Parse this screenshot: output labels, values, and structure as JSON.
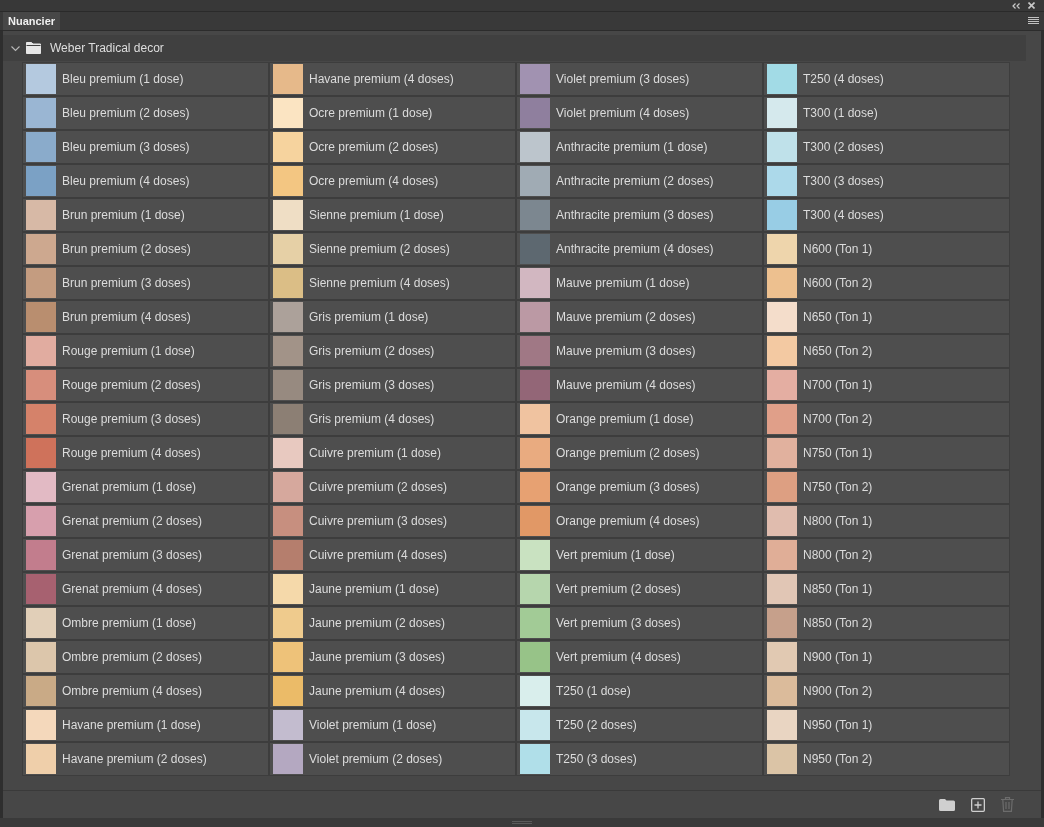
{
  "panel": {
    "tab": {
      "label": "Nuancier",
      "selected": true
    },
    "group": {
      "name": "Weber Tradical decor",
      "expanded": true
    },
    "swatches": [
      {
        "name": "Bleu premium (1 dose)",
        "color": "#b4c9df"
      },
      {
        "name": "Bleu premium (2 doses)",
        "color": "#9ab6d3"
      },
      {
        "name": "Bleu premium (3 doses)",
        "color": "#8aabcb"
      },
      {
        "name": "Bleu premium (4 doses)",
        "color": "#7ba1c5"
      },
      {
        "name": "Brun premium (1 dose)",
        "color": "#d7b9a6"
      },
      {
        "name": "Brun premium (2 doses)",
        "color": "#cda88f"
      },
      {
        "name": "Brun premium (3 doses)",
        "color": "#c49c80"
      },
      {
        "name": "Brun premium (4 doses)",
        "color": "#b98e6f"
      },
      {
        "name": "Rouge premium (1 dose)",
        "color": "#e1aca0"
      },
      {
        "name": "Rouge premium (2 doses)",
        "color": "#d78e7c"
      },
      {
        "name": "Rouge premium (3 doses)",
        "color": "#d5826a"
      },
      {
        "name": "Rouge premium (4 doses)",
        "color": "#cf725b"
      },
      {
        "name": "Grenat premium (1 dose)",
        "color": "#e2bac4"
      },
      {
        "name": "Grenat premium (2 doses)",
        "color": "#d79fad"
      },
      {
        "name": "Grenat premium (3 doses)",
        "color": "#c27d8d"
      },
      {
        "name": "Grenat premium (4 doses)",
        "color": "#a76170"
      },
      {
        "name": "Ombre premium (1 dose)",
        "color": "#e1cfb8"
      },
      {
        "name": "Ombre premium (2 doses)",
        "color": "#dcc6ab"
      },
      {
        "name": "Ombre premium (4 doses)",
        "color": "#c9aa86"
      },
      {
        "name": "Havane premium (1 dose)",
        "color": "#f4d8bb"
      },
      {
        "name": "Havane premium (2 doses)",
        "color": "#efcfaa"
      },
      {
        "name": "Havane premium (4 doses)",
        "color": "#e6b98a"
      },
      {
        "name": "Ocre premium (1 dose)",
        "color": "#fbe4c2"
      },
      {
        "name": "Ocre premium (2 doses)",
        "color": "#f6d39e"
      },
      {
        "name": "Ocre premium (4 doses)",
        "color": "#f3c682"
      },
      {
        "name": "Sienne premium (1 dose)",
        "color": "#efdec5"
      },
      {
        "name": "Sienne premium (2 doses)",
        "color": "#e6d0a6"
      },
      {
        "name": "Sienne premium (4 doses)",
        "color": "#dbbe86"
      },
      {
        "name": "Gris premium (1 dose)",
        "color": "#aca19a"
      },
      {
        "name": "Gris premium (2 doses)",
        "color": "#a29388"
      },
      {
        "name": "Gris premium (3 doses)",
        "color": "#978a80"
      },
      {
        "name": "Gris premium (4 doses)",
        "color": "#8c7f74"
      },
      {
        "name": "Cuivre premium (1 dose)",
        "color": "#e8c9c0"
      },
      {
        "name": "Cuivre premium (2 doses)",
        "color": "#d6a89d"
      },
      {
        "name": "Cuivre premium (3 doses)",
        "color": "#c78f7f"
      },
      {
        "name": "Cuivre premium (4 doses)",
        "color": "#b57e6d"
      },
      {
        "name": "Jaune premium (1 dose)",
        "color": "#f5d9aa"
      },
      {
        "name": "Jaune premium (2 doses)",
        "color": "#efcb8d"
      },
      {
        "name": "Jaune premium (3 doses)",
        "color": "#eec279"
      },
      {
        "name": "Jaune premium (4 doses)",
        "color": "#ebbb68"
      },
      {
        "name": "Violet premium (1 dose)",
        "color": "#c3bccf"
      },
      {
        "name": "Violet premium (2 doses)",
        "color": "#b4a8c1"
      },
      {
        "name": "Violet premium (3 doses)",
        "color": "#a192b1"
      },
      {
        "name": "Violet premium (4 doses)",
        "color": "#8f7f9e"
      },
      {
        "name": "Anthracite premium (1 dose)",
        "color": "#bcc5cc"
      },
      {
        "name": "Anthracite premium (2 doses)",
        "color": "#a0abb4"
      },
      {
        "name": "Anthracite premium (3 doses)",
        "color": "#7c8790"
      },
      {
        "name": "Anthracite premium (4 doses)",
        "color": "#5d6870"
      },
      {
        "name": "Mauve premium (1 dose)",
        "color": "#d2b7c1"
      },
      {
        "name": "Mauve premium (2 doses)",
        "color": "#bb99a4"
      },
      {
        "name": "Mauve premium (3 doses)",
        "color": "#a07885"
      },
      {
        "name": "Mauve premium (4 doses)",
        "color": "#936677"
      },
      {
        "name": "Orange premium (1 dose)",
        "color": "#f0c3a0"
      },
      {
        "name": "Orange premium (2 doses)",
        "color": "#e9ab80"
      },
      {
        "name": "Orange premium (3 doses)",
        "color": "#e7a172"
      },
      {
        "name": "Orange premium (4 doses)",
        "color": "#e19866"
      },
      {
        "name": "Vert premium (1 dose)",
        "color": "#c9e2c1"
      },
      {
        "name": "Vert premium (2 doses)",
        "color": "#b6d6ad"
      },
      {
        "name": "Vert premium (3 doses)",
        "color": "#a2cb96"
      },
      {
        "name": "Vert premium (4 doses)",
        "color": "#97c388"
      },
      {
        "name": "T250 (1 dose)",
        "color": "#d9eeec"
      },
      {
        "name": "T250 (2 doses)",
        "color": "#c8e7ec"
      },
      {
        "name": "T250 (3 doses)",
        "color": "#b0dfe9"
      },
      {
        "name": "T250 (4 doses)",
        "color": "#a2dbe6"
      },
      {
        "name": "T300 (1 dose)",
        "color": "#d5e9ed"
      },
      {
        "name": "T300 (2 doses)",
        "color": "#bfe1ea"
      },
      {
        "name": "T300 (3 doses)",
        "color": "#acd9ea"
      },
      {
        "name": "T300 (4 doses)",
        "color": "#98cde5"
      },
      {
        "name": "N600 (Ton 1)",
        "color": "#eed5ac"
      },
      {
        "name": "N600 (Ton 2)",
        "color": "#edc08f"
      },
      {
        "name": "N650 (Ton 1)",
        "color": "#f4ddcb"
      },
      {
        "name": "N650 (Ton 2)",
        "color": "#f3c9a2"
      },
      {
        "name": "N700 (Ton 1)",
        "color": "#e4aea2"
      },
      {
        "name": "N700 (Ton 2)",
        "color": "#e09f89"
      },
      {
        "name": "N750 (Ton 1)",
        "color": "#e1b19e"
      },
      {
        "name": "N750 (Ton 2)",
        "color": "#dd9f82"
      },
      {
        "name": "N800 (Ton 1)",
        "color": "#e0bcae"
      },
      {
        "name": "N800 (Ton 2)",
        "color": "#e0ae97"
      },
      {
        "name": "N850 (Ton 1)",
        "color": "#e1c6b5"
      },
      {
        "name": "N850 (Ton 2)",
        "color": "#c6a08b"
      },
      {
        "name": "N900 (Ton 1)",
        "color": "#e1c9b2"
      },
      {
        "name": "N900 (Ton 2)",
        "color": "#dbbb9b"
      },
      {
        "name": "N950 (Ton 1)",
        "color": "#e9d5c2"
      },
      {
        "name": "N950 (Ton 2)",
        "color": "#dbc4a6"
      }
    ],
    "footer_buttons": [
      {
        "kind": "folder",
        "disabled": false
      },
      {
        "kind": "new",
        "disabled": false
      },
      {
        "kind": "delete",
        "disabled": true
      }
    ]
  }
}
